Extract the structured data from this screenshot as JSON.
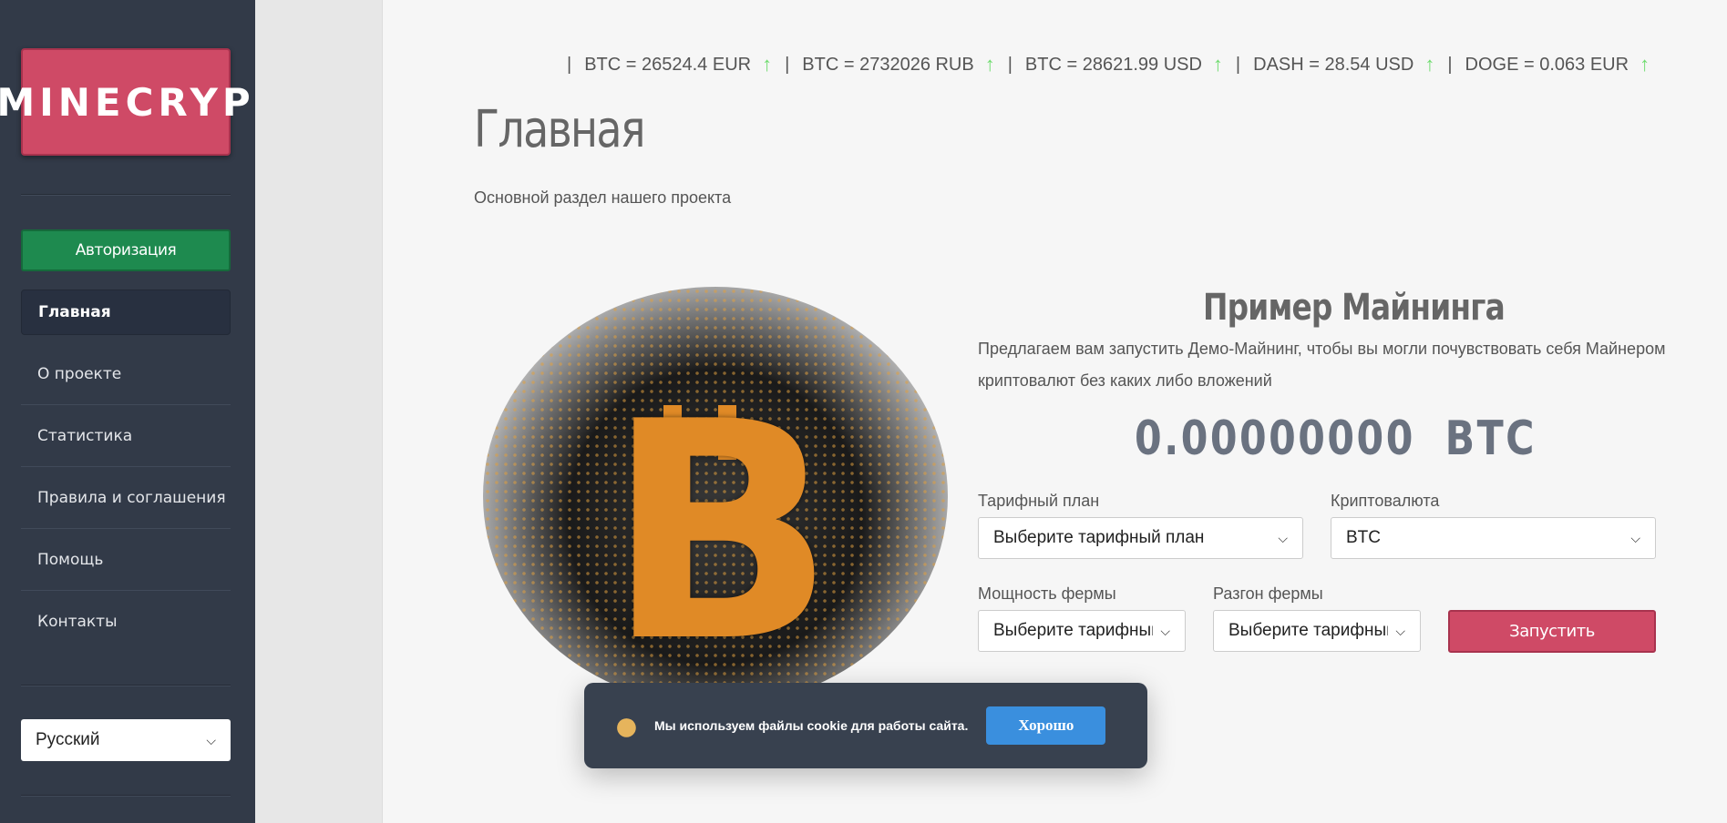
{
  "sidebar": {
    "logo": "MINECRYP",
    "auth_button": "Авторизация",
    "nav": [
      {
        "label": "Главная",
        "active": true
      },
      {
        "label": "О проекте"
      },
      {
        "label": "Статистика"
      },
      {
        "label": "Правила и соглашения"
      },
      {
        "label": "Помощь"
      },
      {
        "label": "Контакты"
      }
    ],
    "language": "Русский"
  },
  "ticker": [
    "BTC = 26524.4 EUR",
    "BTC = 2732026 RUB",
    "BTC = 28621.99 USD",
    "DASH = 28.54 USD",
    "DOGE = 0.063 EUR"
  ],
  "page": {
    "title": "Главная",
    "subtitle": "Основной раздел нашего проекта"
  },
  "mining": {
    "title": "Пример Майнинга",
    "description": "Предлагаем вам запустить Демо-Майнинг, чтобы вы могли почувствовать себя Майнером криптовалют без каких либо вложений",
    "amount": "0.00000000",
    "currency": "BTC",
    "tariff_label": "Тарифный план",
    "tariff_value": "Выберите тарифный план",
    "crypto_label": "Криптовалюта",
    "crypto_value": "BTC",
    "power_label": "Мощность фермы",
    "power_value": "Выберите тарифный план",
    "boost_label": "Разгон фермы",
    "boost_value": "Выберите тарифный план",
    "run_button": "Запустить"
  },
  "cookie": {
    "text": "Мы используем файлы cookie для работы сайта.",
    "button": "Хорошо"
  },
  "colors": {
    "sidebar": "#323a48",
    "accent_red": "#cf4a66",
    "accent_green": "#1e8a4f",
    "cookie_button": "#3a8fde",
    "ticker_arrow": "#6fdc6f"
  }
}
